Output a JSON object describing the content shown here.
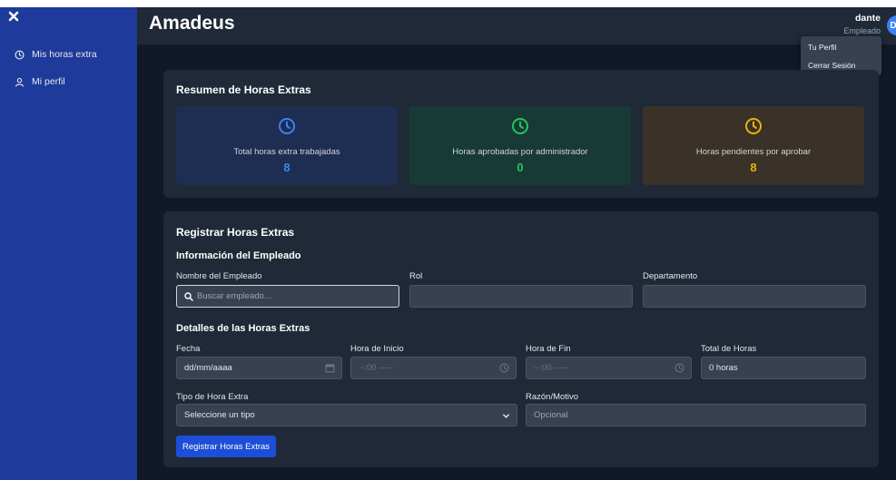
{
  "sidebar": {
    "items": [
      {
        "label": "Mis horas extra",
        "icon": "clock-icon"
      },
      {
        "label": "Mi perfil",
        "icon": "user-icon"
      }
    ]
  },
  "header": {
    "title": "Amadeus",
    "user_name": "dante",
    "user_role": "Empleado",
    "avatar_initial": "D"
  },
  "user_menu": {
    "items": [
      "Tu Perfil",
      "Cerrar Sesión"
    ]
  },
  "summary": {
    "title": "Resumen de Horas Extras",
    "stats": [
      {
        "label": "Total horas extra trabajadas",
        "value": "8",
        "color": "#3b82f6",
        "bg": "#1e2d52"
      },
      {
        "label": "Horas aprobadas por administrador",
        "value": "0",
        "color": "#22c55e",
        "bg": "#173a35"
      },
      {
        "label": "Horas pendientes por aprobar",
        "value": "8",
        "color": "#eab308",
        "bg": "#3a3128"
      }
    ]
  },
  "register": {
    "title": "Registrar Horas Extras",
    "employee_section": "Información del Empleado",
    "labels": {
      "name": "Nombre del Empleado",
      "role": "Rol",
      "department": "Departamento",
      "date": "Fecha",
      "start": "Hora de Inicio",
      "end": "Hora de Fin",
      "total": "Total de Horas",
      "type": "Tipo de Hora Extra",
      "reason": "Razón/Motivo"
    },
    "search_placeholder": "Buscar empleado...",
    "details_section": "Detalles de las Horas Extras",
    "date_placeholder": "dd/mm/aaaa",
    "time_placeholder": "--:00 -----",
    "total_value": "0 horas",
    "type_selected": "Seleccione un tipo",
    "reason_placeholder": "Opcional",
    "submit_label": "Registrar Horas Extras"
  },
  "colors": {
    "sidebar": "#1e3a9a",
    "accent": "#1d4ed8"
  }
}
